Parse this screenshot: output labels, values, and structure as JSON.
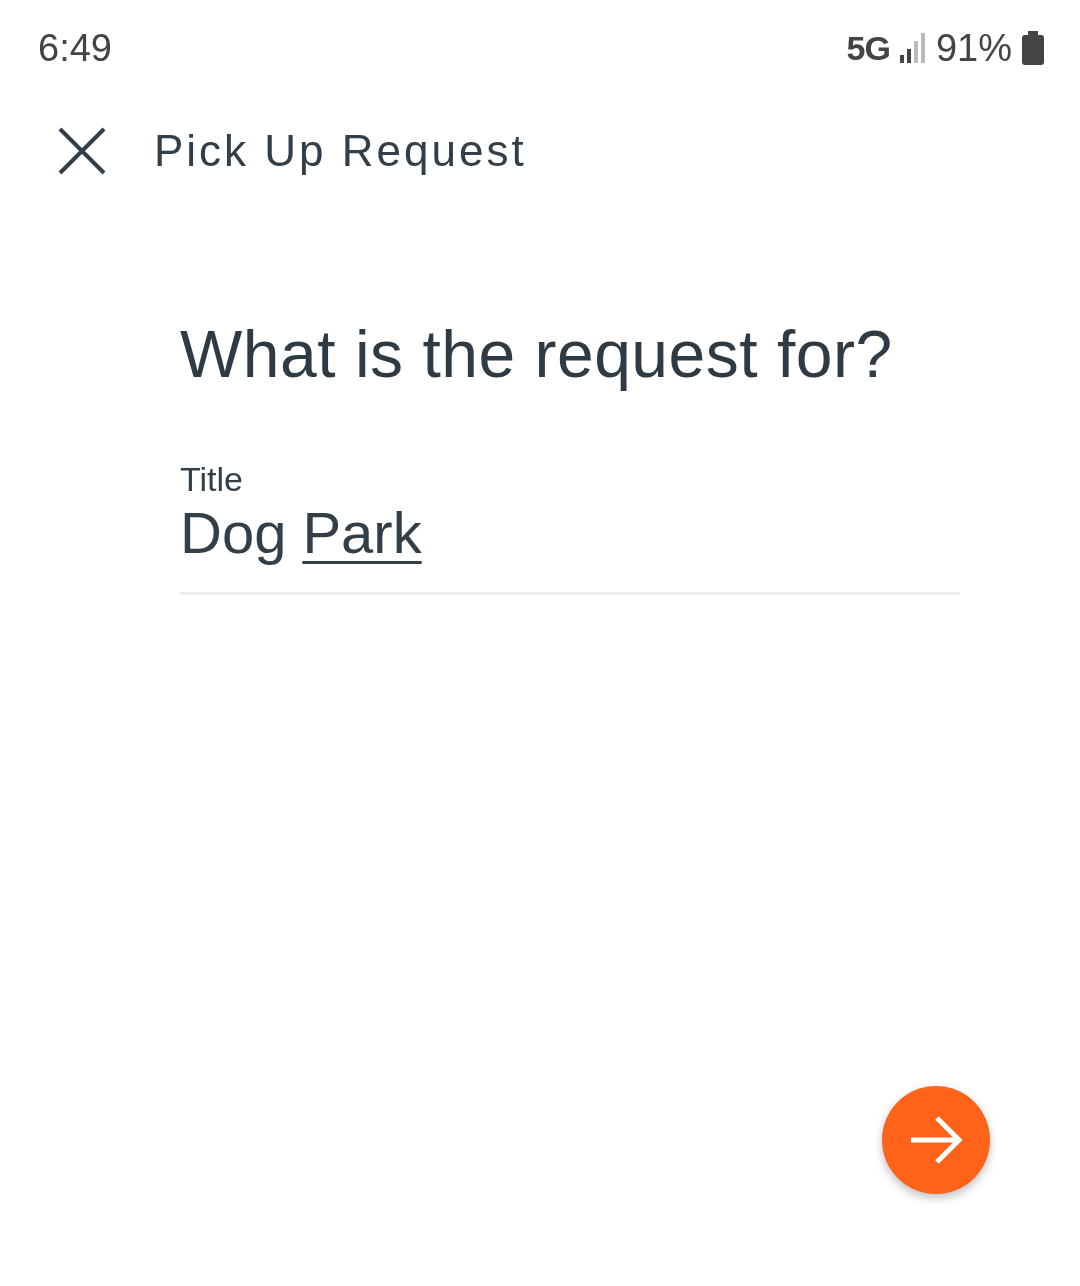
{
  "status_bar": {
    "time": "6:49",
    "network": "5G",
    "battery": "91%"
  },
  "header": {
    "title": "Pick Up Request"
  },
  "question": "What is the request for?",
  "field": {
    "label": "Title",
    "value_parts": [
      {
        "text": "Dog",
        "underlined": false
      },
      {
        "text": "Park",
        "underlined": true
      }
    ]
  },
  "next_button": {
    "kind": "arrow"
  }
}
